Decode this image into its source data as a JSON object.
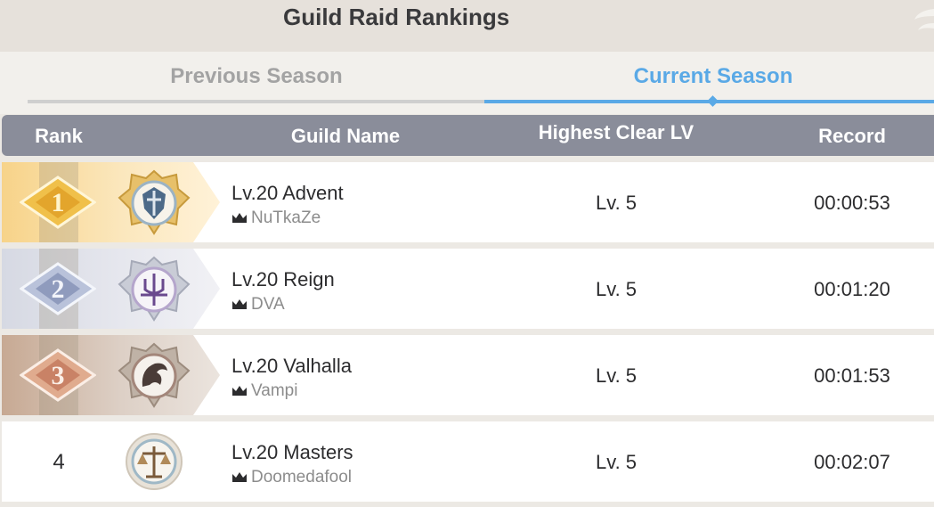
{
  "title": "Guild Raid Rankings",
  "tabs": [
    {
      "label": "Previous Season",
      "active": false
    },
    {
      "label": "Current Season",
      "active": true
    }
  ],
  "colors": {
    "accent": "#5aa9e6",
    "header_bg": "#8a8d9a",
    "gold": "#f7d389",
    "silver": "#d6d9e3",
    "bronze": "#c7a993"
  },
  "table": {
    "columns": [
      "Rank",
      "Guild Name",
      "Highest Clear LV",
      "Record"
    ],
    "rows": [
      {
        "rank": "1",
        "guild": "Lv.20 Advent",
        "leader": "NuTkaZe",
        "clear": "Lv. 5",
        "record": "00:00:53",
        "medal": "gold-medal-icon",
        "emblem": "gold-shield-emblem-icon"
      },
      {
        "rank": "2",
        "guild": "Lv.20 Reign",
        "leader": "DVA",
        "clear": "Lv. 5",
        "record": "00:01:20",
        "medal": "silver-medal-icon",
        "emblem": "trident-emblem-icon"
      },
      {
        "rank": "3",
        "guild": "Lv.20 Valhalla",
        "leader": "Vampi",
        "clear": "Lv. 5",
        "record": "00:01:53",
        "medal": "bronze-medal-icon",
        "emblem": "dragon-emblem-icon"
      },
      {
        "rank": "4",
        "guild": "Lv.20 Masters",
        "leader": "Doomedafool",
        "clear": "Lv. 5",
        "record": "00:02:07",
        "emblem": "scales-emblem-icon"
      }
    ]
  }
}
